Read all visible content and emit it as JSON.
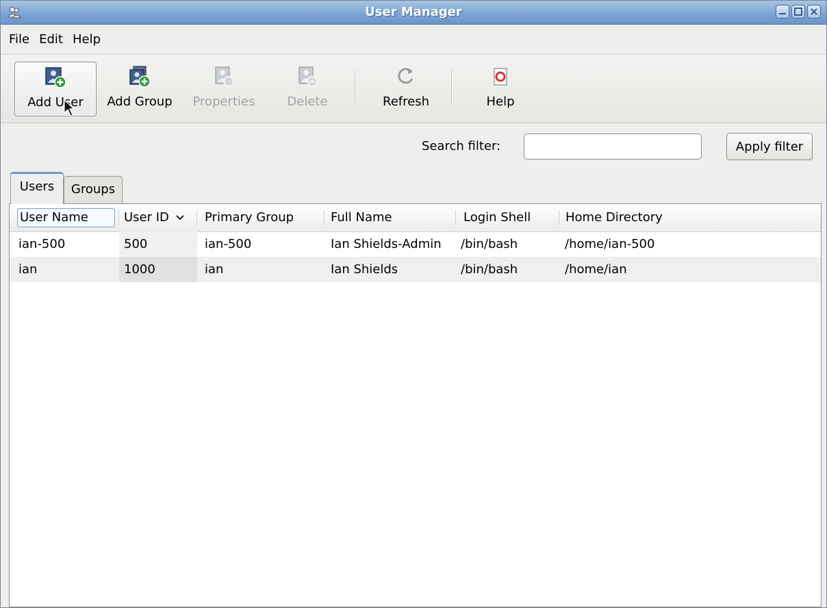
{
  "window": {
    "title": "User Manager"
  },
  "menu": {
    "items": [
      "File",
      "Edit",
      "Help"
    ]
  },
  "toolbar": {
    "add_user": "Add User",
    "add_group": "Add Group",
    "properties": "Properties",
    "delete": "Delete",
    "refresh": "Refresh",
    "help": "Help"
  },
  "filter": {
    "label": "Search filter:",
    "value": "",
    "apply": "Apply filter"
  },
  "tabs": [
    {
      "label": "Users",
      "active": true
    },
    {
      "label": "Groups",
      "active": false
    }
  ],
  "table": {
    "columns": [
      "User Name",
      "User ID",
      "Primary Group",
      "Full Name",
      "Login Shell",
      "Home Directory"
    ],
    "sort_column": "User ID",
    "rows": [
      [
        "ian-500",
        "500",
        "ian-500",
        "Ian Shields-Admin",
        "/bin/bash",
        "/home/ian-500"
      ],
      [
        "ian",
        "1000",
        "ian",
        "Ian Shields",
        "/bin/bash",
        "/home/ian"
      ]
    ]
  },
  "colors": {
    "titlebar": "#7ea5d4",
    "tab_accent": "#6c97cc",
    "add_badge": "#2e9b3a"
  }
}
